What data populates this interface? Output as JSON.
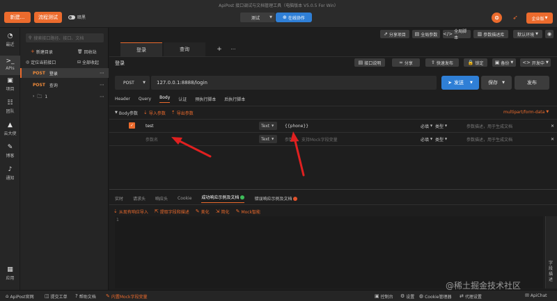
{
  "window": {
    "title": "ApiPost 接口调试与文档管理工具（电脑版本 V5.0.5 For Win）"
  },
  "topbar": {
    "new_label": "新建...",
    "process_test_label": "流程测试",
    "theme_label": "暗黑",
    "env_select": "测试",
    "collab_label": "在线协作",
    "enterprise_label": "企业版",
    "colors": {
      "accent_orange": "#ec6b2d",
      "accent_blue": "#2f7fd6"
    }
  },
  "toolbar_right": {
    "share_project": "分享项目",
    "global_params": "全局参数",
    "global_script": "全局脚本",
    "param_desc_lib": "参数描述库",
    "default_env": "默认环境"
  },
  "rail": {
    "items": [
      {
        "label": "最近",
        "icon": "clock-icon"
      },
      {
        "label": "APIs",
        "icon": "terminal-icon"
      },
      {
        "label": "项目",
        "icon": "briefcase-icon"
      },
      {
        "label": "团队",
        "icon": "team-icon"
      },
      {
        "label": "云大使",
        "icon": "graduation-icon"
      },
      {
        "label": "博客",
        "icon": "edit-icon"
      },
      {
        "label": "通知",
        "icon": "bell-icon"
      },
      {
        "label": "应用",
        "icon": "apps-icon"
      }
    ]
  },
  "tree": {
    "search_placeholder": "搜索接口路径、接口、文档",
    "new_dir": "新建目录",
    "recycle": "回收站",
    "locate": "定位当前接口",
    "collapse_all": "全部收起",
    "items": [
      {
        "method": "POST",
        "name": "登录"
      },
      {
        "method": "POST",
        "name": "查询"
      },
      {
        "folder": "1"
      }
    ]
  },
  "tabs": {
    "items": [
      "登录",
      "查询"
    ],
    "add": "+",
    "more": "···"
  },
  "request": {
    "name": "登录",
    "doc_btn": "接口说明",
    "share_btn": "分享",
    "quick_publish": "快速发布",
    "lock_btn": "锁定",
    "backup_btn": "备份",
    "status_select": "开发中",
    "method": "POST",
    "url": "127.0.0.1:8888/login",
    "send": "发送",
    "save": "保存",
    "publish": "发布"
  },
  "subtabs": {
    "items": [
      "Header",
      "Query",
      "Body",
      "认证",
      "预执行脚本",
      "后执行脚本"
    ],
    "active": "Body"
  },
  "body": {
    "section_label": "Body参数",
    "import_label": "导入参数",
    "export_label": "导出参数",
    "content_type": "multipart/form-data",
    "rows": [
      {
        "key": "test",
        "type": "Text",
        "value": "{{phone}}",
        "required": "必填",
        "ptype": "类型",
        "desc_placeholder": "参数描述，用于生成文档",
        "checked": true
      },
      {
        "key": "参数名",
        "type": "Text",
        "value": "参数值，支持Mock字段变量",
        "required": "必填",
        "ptype": "类型",
        "desc_placeholder": "参数描述，用于生成文档",
        "checked": false
      }
    ]
  },
  "response": {
    "tabs": [
      "实时",
      "请求头",
      "响应头",
      "Cookie",
      "成功响应示例及文档",
      "错误响应示例及文档"
    ],
    "actions": [
      "从现有响应导入",
      "提取字段和描述",
      "美化",
      "简化",
      "Mock智能"
    ],
    "side_label": "字段描述",
    "line_no": "1"
  },
  "statusbar": {
    "left": [
      "ApiPost官网",
      "提交工单",
      "帮助文档",
      "内置Mock字段变量"
    ],
    "right": [
      "控制台",
      "设置",
      "Cookie管理器",
      "代理设置",
      "ApiChat"
    ],
    "watermark": "@稀土掘金技术社区"
  }
}
